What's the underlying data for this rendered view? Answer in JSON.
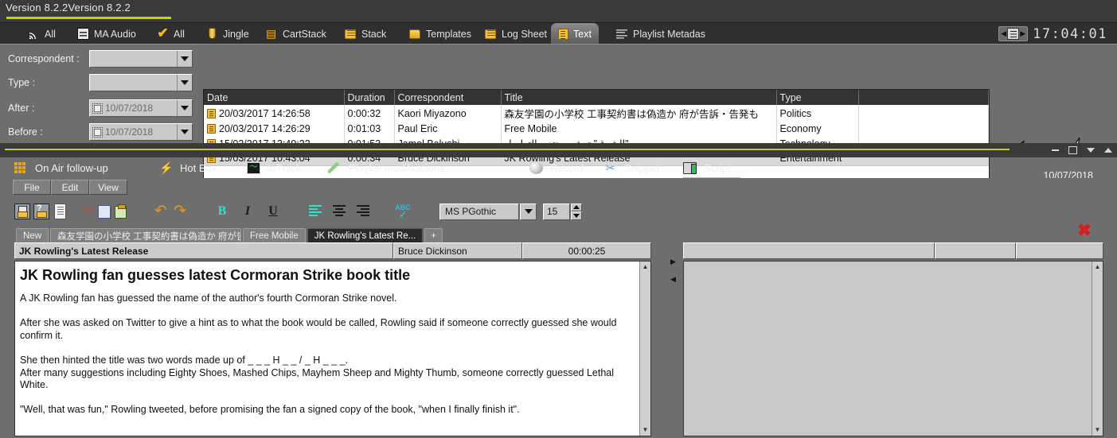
{
  "version_bar": {
    "text": "Version 8.2.2Version 8.2.2"
  },
  "nav": {
    "tabs": [
      {
        "label": "All",
        "icon": "rss-icon",
        "active": false
      },
      {
        "label": "MA Audio",
        "icon": "mixer-icon",
        "active": false
      },
      {
        "label": "All",
        "icon": "checkmark-icon",
        "active": false
      },
      {
        "label": "Jingle",
        "icon": "jingle-icon",
        "active": false
      },
      {
        "label": "CartStack",
        "icon": "cartstack-icon",
        "active": false
      },
      {
        "label": "Stack",
        "icon": "stack-icon",
        "active": false
      },
      {
        "label": "Templates",
        "icon": "folder-icon",
        "active": false
      },
      {
        "label": "Log Sheet",
        "icon": "logsheet-icon",
        "active": false
      },
      {
        "label": "Text",
        "icon": "text-icon",
        "active": true
      },
      {
        "label": "Playlist Metadas",
        "icon": "metadata-icon",
        "active": false
      }
    ],
    "clock": "17:04:01"
  },
  "filters": {
    "rows": [
      {
        "label": "Correspondent :",
        "value": "",
        "type": "combo"
      },
      {
        "label": "Type :",
        "value": "",
        "type": "combo"
      },
      {
        "label": "After :",
        "value": "10/07/2018",
        "type": "date"
      },
      {
        "label": "Before :",
        "value": "10/07/2018",
        "type": "date"
      }
    ]
  },
  "news_table": {
    "columns": [
      "Date",
      "Duration",
      "Correspondent",
      "Title",
      "Type",
      ""
    ],
    "rows": [
      {
        "date": "20/03/2017 14:26:58",
        "duration": "0:00:32",
        "correspondent": "Kaori Miyazono",
        "title": "森友学園の小学校 工事契約書は偽造か 府が告訴・告発も",
        "type": "Politics",
        "selected": false
      },
      {
        "date": "20/03/2017 14:26:29",
        "duration": "0:01:03",
        "correspondent": "Paul Eric",
        "title": "Free Mobile",
        "type": "Economy",
        "selected": false
      },
      {
        "date": "15/03/2017 13:49:22",
        "duration": "0:01:53",
        "correspondent": "Jamel Balushi",
        "title": "\"الشرق\" تدشن منتدى التواصل",
        "type": "Technology",
        "selected": false
      },
      {
        "date": "15/03/2017 10:43:04",
        "duration": "0:00:34",
        "correspondent": "Bruce Dickinson",
        "title": "JK Rowling's Latest Release",
        "type": "Entertainment",
        "selected": true
      }
    ]
  },
  "right_tools": {
    "search_icon": "magnifier-icon",
    "flash_icon": "lightning-bolt-icon",
    "date": "10/07/2018"
  },
  "modules": {
    "tabs": [
      {
        "label": "On Air follow-up",
        "icon": "grid-icon",
        "active": false
      },
      {
        "label": "Hot Box",
        "icon": "lightning-icon",
        "active": false
      },
      {
        "label": "InTrack",
        "icon": "waveform-screen-icon",
        "active": false
      },
      {
        "label": "Playlist modifications",
        "icon": "pencil-icon",
        "active": false
      },
      {
        "label": "Record",
        "icon": "record-circle-icon",
        "active": false
      },
      {
        "label": "Snippet",
        "icon": "scissors-icon",
        "active": false
      },
      {
        "label": "Script",
        "icon": "script-icon",
        "active": true
      }
    ]
  },
  "editor": {
    "menu": [
      "File",
      "Edit",
      "View"
    ],
    "toolbar_icons": [
      "save-icon",
      "save-as-icon",
      "new-document-icon",
      "cut-icon",
      "copy-icon",
      "paste-icon",
      "undo-icon",
      "redo-icon",
      "bold-icon",
      "italic-icon",
      "underline-icon",
      "align-left-icon",
      "align-center-icon",
      "align-right-icon",
      "spellcheck-icon"
    ],
    "font_name": "MS PGothic",
    "font_size": "15",
    "doc_tabs": [
      {
        "label": "New",
        "active": false
      },
      {
        "label": "森友学園の小学校 工事契約書は偽造か 府が告...",
        "active": false
      },
      {
        "label": "Free Mobile",
        "active": false
      },
      {
        "label": "JK Rowling's Latest Re...",
        "active": true
      },
      {
        "label": "+",
        "active": false
      }
    ],
    "close_label": "✖"
  },
  "document_left": {
    "title": "JK Rowling's Latest Release",
    "correspondent": "Bruce Dickinson",
    "duration": "00:00:25",
    "headline": "JK Rowling fan guesses latest Cormoran Strike book title",
    "paragraphs": [
      "A JK Rowling fan has guessed the name of the author's fourth Cormoran Strike novel.",
      "After she was asked on Twitter to give a hint as to what the book would be called, Rowling said if someone correctly guessed she would confirm it.",
      "She then hinted the title was two words made up of _ _ _ H _ _ / _ H _ _ _.\nAfter many suggestions including Eighty Shoes, Mashed Chips, Mayhem Sheep and Mighty Thumb, someone correctly guessed Lethal White.",
      "\"Well, that was fun,\" Rowling tweeted, before promising the fan a signed copy of the book, \"when I finally finish it\"."
    ]
  },
  "document_right": {
    "title": "",
    "correspondent": "",
    "duration": ""
  },
  "window_controls": {
    "minimize": "minimize-icon",
    "maximize": "maximize-icon",
    "collapse": "collapse-down-icon",
    "expand": "expand-up-icon"
  },
  "colors": {
    "accent_yellow": "#c8d400",
    "panel_gray": "#6e6e6e",
    "dark_bar": "#2f2f2f",
    "icon_gold": "#f3c13a",
    "active_teal": "#35e0c8",
    "close_red": "#cc2222"
  }
}
